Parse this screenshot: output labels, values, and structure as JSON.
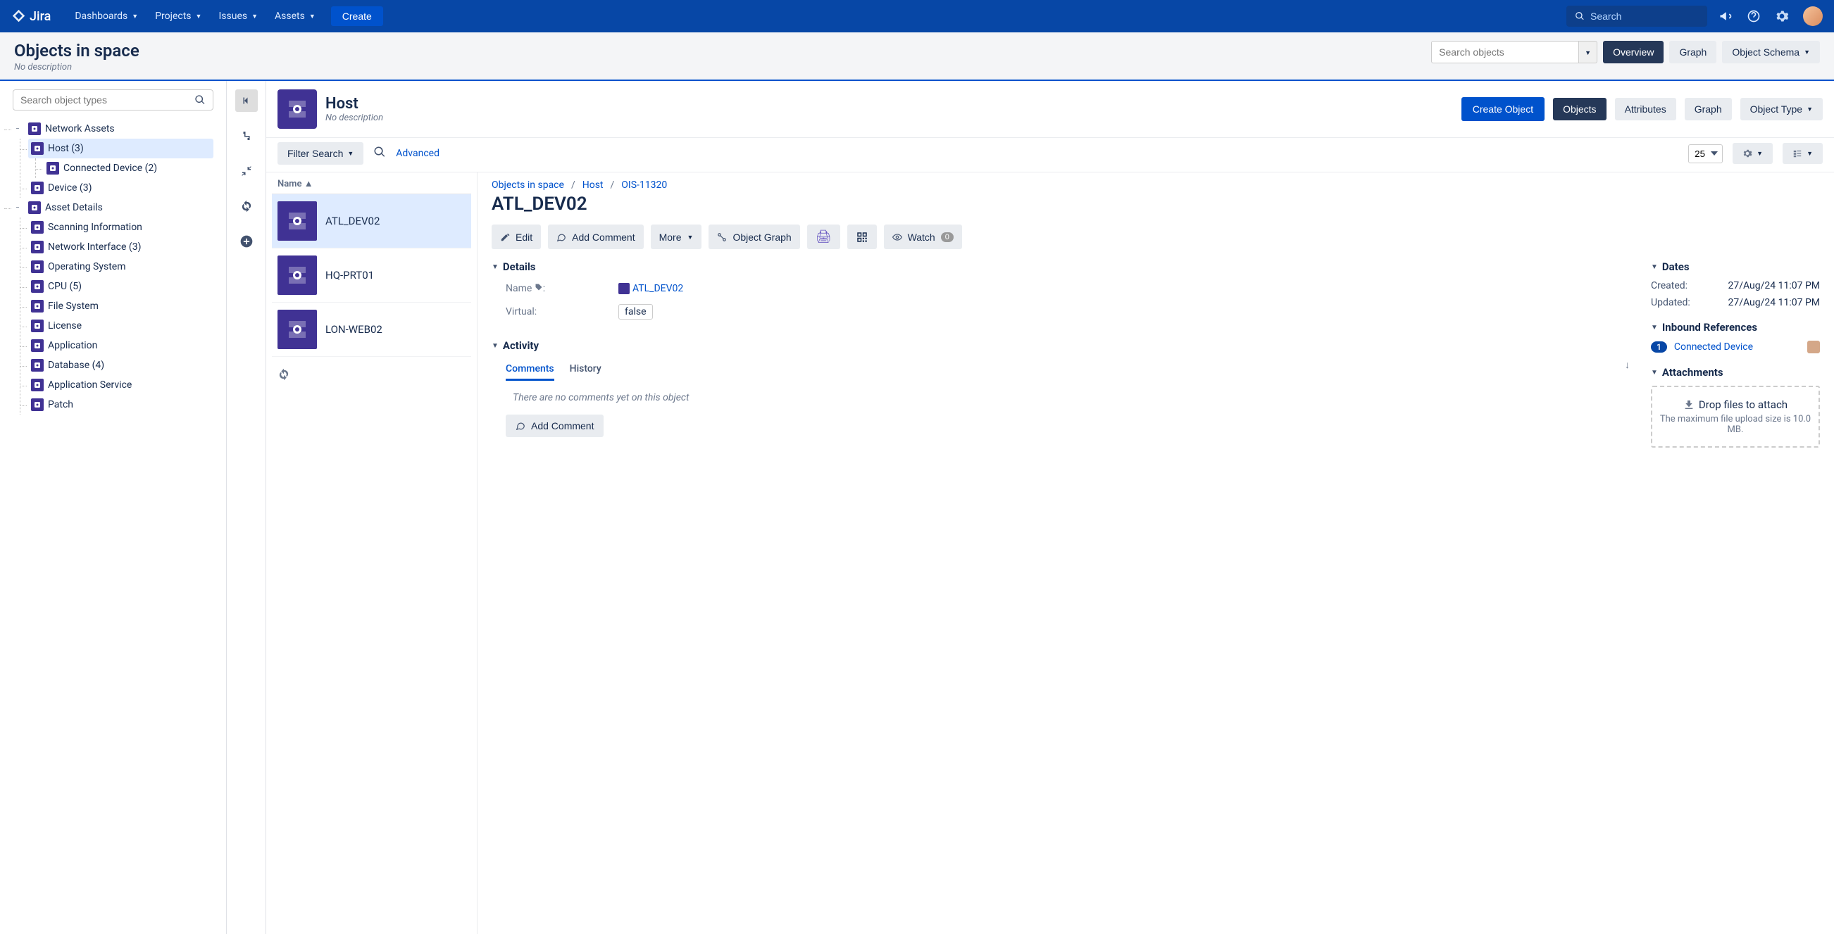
{
  "topnav": {
    "logo": "Jira",
    "items": [
      "Dashboards",
      "Projects",
      "Issues",
      "Assets"
    ],
    "create": "Create",
    "search_placeholder": "Search"
  },
  "page": {
    "title": "Objects in space",
    "desc": "No description",
    "search_placeholder": "Search objects",
    "overview": "Overview",
    "graph": "Graph",
    "schema": "Object Schema"
  },
  "sidebar": {
    "search_placeholder": "Search object types",
    "tree": [
      {
        "label": "Network Assets",
        "children": [
          {
            "label": "Host (3)",
            "selected": true,
            "children": [
              {
                "label": "Connected Device (2)"
              }
            ]
          },
          {
            "label": "Device (3)"
          }
        ]
      },
      {
        "label": "Asset Details",
        "children": [
          {
            "label": "Scanning Information"
          },
          {
            "label": "Network Interface (3)"
          },
          {
            "label": "Operating System"
          },
          {
            "label": "CPU (5)"
          },
          {
            "label": "File System"
          },
          {
            "label": "License"
          },
          {
            "label": "Application"
          },
          {
            "label": "Database (4)"
          },
          {
            "label": "Application Service"
          },
          {
            "label": "Patch"
          }
        ]
      }
    ]
  },
  "content": {
    "type_title": "Host",
    "type_desc": "No description",
    "create_object": "Create Object",
    "tabs": {
      "objects": "Objects",
      "attributes": "Attributes",
      "graph": "Graph",
      "object_type": "Object Type"
    },
    "filter_search": "Filter Search",
    "advanced": "Advanced",
    "page_size": "25",
    "list_header": "Name",
    "list": [
      {
        "name": "ATL_DEV02",
        "selected": true
      },
      {
        "name": "HQ-PRT01"
      },
      {
        "name": "LON-WEB02"
      }
    ]
  },
  "detail": {
    "breadcrumb": [
      "Objects in space",
      "Host",
      "OIS-11320"
    ],
    "title": "ATL_DEV02",
    "actions": {
      "edit": "Edit",
      "add_comment": "Add Comment",
      "more": "More",
      "object_graph": "Object Graph",
      "watch": "Watch",
      "watch_count": "0"
    },
    "details_section": "Details",
    "name_label": "Name",
    "name_value": "ATL_DEV02",
    "virtual_label": "Virtual:",
    "virtual_value": "false",
    "activity_section": "Activity",
    "activity_tabs": {
      "comments": "Comments",
      "history": "History"
    },
    "no_comments": "There are no comments yet on this object",
    "add_comment_btn": "Add Comment",
    "dates_section": "Dates",
    "created_label": "Created:",
    "created_value": "27/Aug/24 11:07 PM",
    "updated_label": "Updated:",
    "updated_value": "27/Aug/24 11:07 PM",
    "inbound_section": "Inbound References",
    "inbound_count": "1",
    "inbound_label": "Connected Device",
    "attachments_section": "Attachments",
    "dropzone_title": "Drop files to attach",
    "dropzone_sub": "The maximum file upload size is 10.0 MB."
  }
}
